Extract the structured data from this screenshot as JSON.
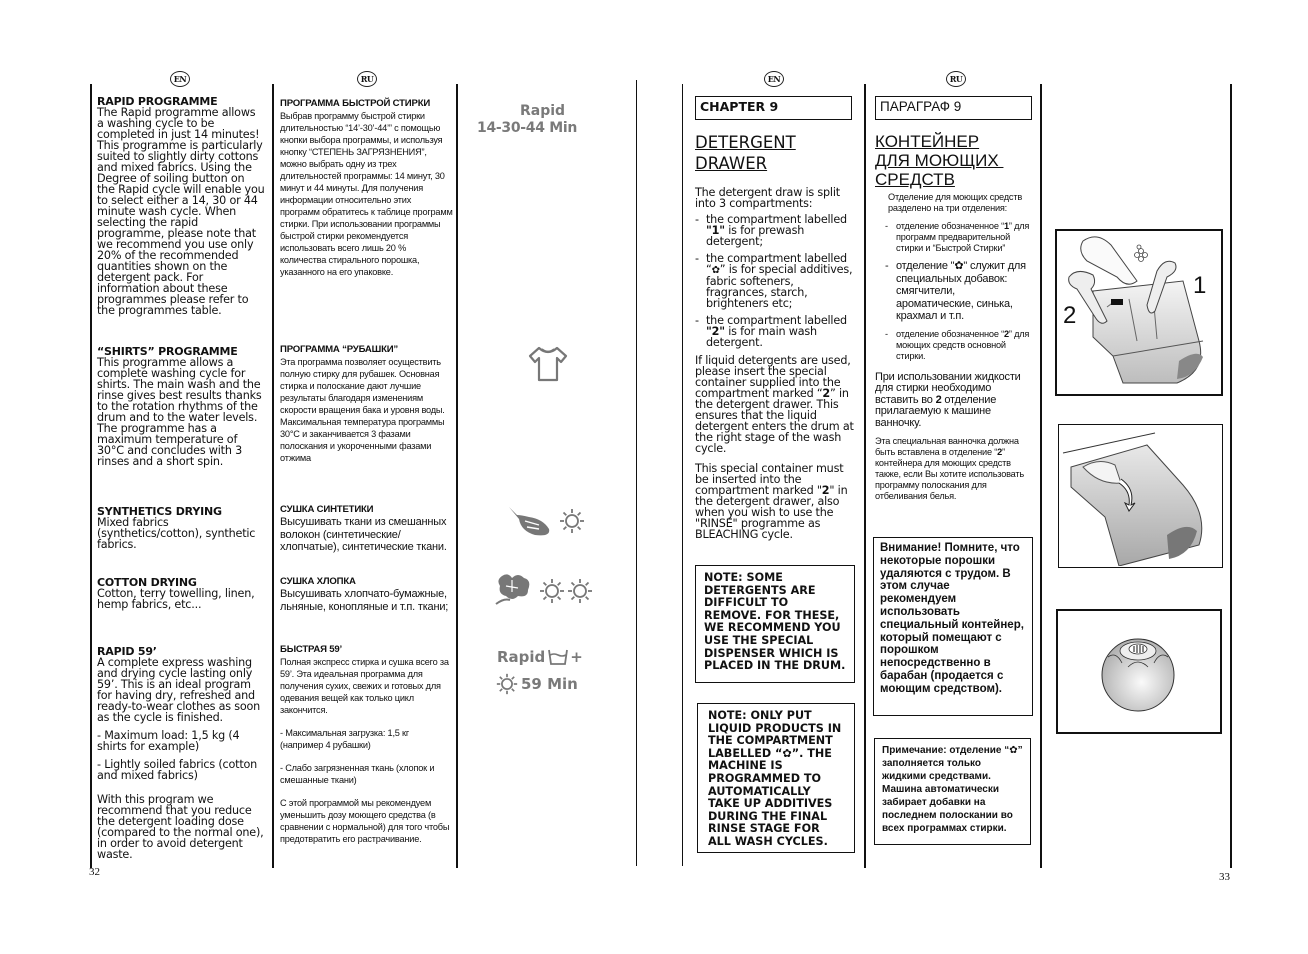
{
  "left_page": {
    "page_number": "32",
    "en": {
      "badge": "EN",
      "sections": [
        {
          "title": "RAPID PROGRAMME",
          "body": "The Rapid programme allows a washing cycle to be completed in just 14 minutes! This programme is particularly suited to slightly dirty cottons and mixed fabrics. Using the Degree of soiling button on the Rapid cycle will enable you to select either a 14, 30 or 44 minute wash cycle. When selecting the rapid programme, please note that we recommend you use only 20% of the recommended quantities shown on the detergent pack. For information about these programmes please refer to the programmes table."
        },
        {
          "title": "“SHIRTS” PROGRAMME",
          "body": "This programme allows a complete washing cycle for shirts. The main wash and the rinse gives best results thanks to the rotation rhythms of the drum and to the water levels. The programme has a maximum temperature of 30°C and concludes with 3 rinses and a short spin."
        },
        {
          "title": "SYNTHETICS DRYING",
          "body": "Mixed fabrics (synthetics/cotton), synthetic fabrics."
        },
        {
          "title": "COTTON DRYING",
          "body": "Cotton, terry towelling, linen, hemp fabrics, etc..."
        },
        {
          "title": "RAPID  59’",
          "body": "A complete express washing and drying cycle lasting only 59’. This is an ideal program for having  dry, refreshed and ready-to-wear clothes as soon as the cycle is finished.",
          "extra": [
            "- Maximum load: 1,5 kg (4 shirts for example)",
            "- Lightly soiled fabrics (cotton and mixed fabrics)",
            "With this program we recommend that you reduce the detergent loading dose (compared to the normal one), in order to avoid detergent waste."
          ]
        }
      ]
    },
    "ru": {
      "badge": "RU",
      "sections": [
        {
          "title": "ПРОГРАММА БЫСТРОЙ СТИРКИ",
          "body": "Выбрав программу быстрой стирки длительностью “14’-30’-44’” с помощью кнопки выбора программы, и используя кнопку “СТЕПЕНЬ ЗАГРЯЗНЕНИЯ”, можно выбрать одну из трех длительностей программы: 14 минут, 30 минут и 44 минуты. Для получения информации относительно этих программ обратитесь к таблице программ стирки. При использовании программы быстрой стирки рекомендуется использовать всего лишь 20 % количества стирального порошка, указанного на его упаковке."
        },
        {
          "title": "ПРОГРАММА “РУБАШКИ”",
          "body": "Эта программа позволяет осуществить полную стирку для рубашек. Основная стирка и полоскание дают лучшие результаты благодаря изменениям скорости вращения бака и уровня воды. Максимальная температура программы 30°C и заканчивается 3 фазами полоскания и укороченными фазами отжима"
        },
        {
          "title": "СУШКА СИНТЕТИКИ",
          "body": "Высушивать ткани из смешанных волокон (синтетические/хлопчатые), синтетические ткани."
        },
        {
          "title": "СУШКА ХЛОПКА",
          "body": "Высушивать хлопчато-бумажные, льняные, конопляные и т.п. ткани;"
        },
        {
          "title": "БЫСТРАЯ  59’",
          "body": "Полная экспресс стирка и сушка всего за 59’. Эта идеальная программа для получения сухих, свежих и готовых для одевания вещей как только цикл закончится.",
          "extra": [
            "- Максимальная загрузка: 1,5 кг (например 4 рубашки)",
            "- Слабо загрязненная ткань (хлопок и смешанные ткани)",
            "С этой программой мы рекомендуем уменьшить дозу моющего средства (в сравнении с нормальной) для того чтобы предотвратить его растрачивание."
          ]
        }
      ]
    },
    "symbols": {
      "rapid_line1": "Rapid",
      "rapid_line2": "14-30-44 Min",
      "shirt_icon": "shirt-icon",
      "synthetics_icon": "feather-sun-icon",
      "cotton_icon": "cotton-two-suns-icon",
      "rapid59_line1": "Rapid",
      "rapid59_plus": "+",
      "rapid59_line2": "59 Min"
    }
  },
  "right_page": {
    "page_number": "33",
    "en": {
      "badge": "EN",
      "chapter": "CHAPTER 9",
      "title_lines": [
        "DETERGENT",
        "DRAWER"
      ],
      "intro": "The detergent draw is split into 3 compartments:",
      "items": [
        {
          "pre": "the compartment labelled ",
          "bold": "\"1\"",
          "post": " is for prewash detergent;"
        },
        {
          "pre": "the compartment labelled “",
          "symbol": "flower-icon",
          "post": "” is for special additives, fabric softeners, fragrances, starch, brighteners etc;"
        },
        {
          "pre": "the compartment labelled ",
          "bold": "\"2\"",
          "post": " is for main wash detergent."
        }
      ],
      "para1": {
        "pre": "If liquid detergents are used, please insert the special container supplied into the compartment marked “",
        "bold": "2",
        "post": "” in the detergent drawer. This ensures that the liquid detergent enters the drum at the right stage of the wash cycle."
      },
      "para2": {
        "pre": "This special container must be inserted into the compartment marked \"",
        "bold": "2",
        "post": "\" in the detergent drawer, also when you wish to use the \"RINSE\" programme as BLEACHING cycle."
      },
      "note1": "NOTE: SOME DETERGENTS ARE DIFFICULT TO REMOVE. FOR THESE, WE RECOMMEND YOU USE THE SPECIAL DISPENSER WHICH IS PLACED IN THE DRUM.",
      "note2_pre": "NOTE: ONLY PUT LIQUID PRODUCTS IN THE COMPARTMENT LABELLED “",
      "note2_post": "”. THE MACHINE IS PROGRAMMED TO AUTOMATICALLY TAKE UP ADDITIVES DURING THE FINAL RINSE STAGE FOR ALL WASH CYCLES."
    },
    "ru": {
      "badge": "RU",
      "chapter": "ПАРАГРАФ 9",
      "title_lines": [
        "КОНТЕЙНЕР",
        "ДЛЯ МОЮЩИХ ",
        "СРЕДСТВ"
      ],
      "intro": "Отделение для моющих средств разделено на три отделения:",
      "items": [
        {
          "pre": "отделение обозначенное “",
          "bold": "1",
          "post": "” для программ предварительной стирки и “Быстрой Стирки”"
        },
        {
          "pre": "отделение \"",
          "symbol": "flower-icon",
          "post": "\" служит для специальных добавок: смягчители, ароматические, синька, крахмал и т.п."
        },
        {
          "pre": "отделение обозначенное “",
          "bold": "2",
          "post": "” для моющих средств основной стирки."
        }
      ],
      "para1": {
        "pre": "При использовании жидкости для стирки необходимо вставить во ",
        "bold": "2",
        "post": " отделение прилагаемую к машине ванночку."
      },
      "para2": {
        "pre": "Эта специальная ванночка должна быть вставлена в отделение “",
        "bold": "2",
        "post": "” контейнера для моющих средств также, если Вы хотите использовать программу полоскания  для отбеливания белья."
      },
      "note1": "Внимание! Помните, что некоторые порошки удаляются с трудом. В этом случае рекомендуем использовать специальный контейнер, который помещают с  порошком непосредственно в барабан (продается с моющим средством).",
      "note2_pre": "Примечание: отделение “",
      "note2_post": "” заполняется только жидкими средствами. Машина автоматически забирает добавки на последнем полоскании во всех программах стирки."
    },
    "figures": {
      "fig1_label_1": "1",
      "fig1_label_2": "2",
      "fig1": "detergent-drawer-pouring-illustration",
      "fig2": "liquid-container-insert-illustration",
      "fig3": "dispenser-ball-illustration"
    }
  }
}
